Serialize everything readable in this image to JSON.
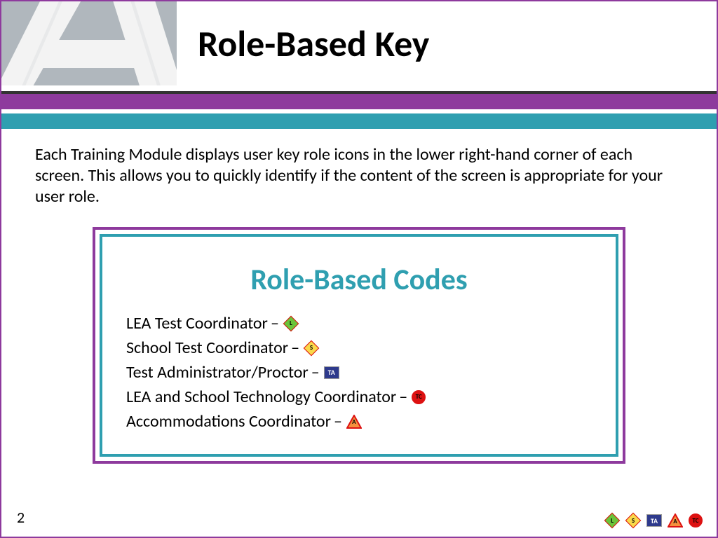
{
  "title": "Role-Based Key",
  "intro": "Each Training Module displays user key role icons in the lower right-hand corner of each screen. This allows you to quickly identify if the content of the screen is appropriate for your user role.",
  "codes_heading": "Role-Based Codes",
  "roles": [
    {
      "label": "LEA Test Coordinator",
      "badge": "L"
    },
    {
      "label": "School Test Coordinator",
      "badge": "S"
    },
    {
      "label": "Test Administrator/Proctor",
      "badge": "TA"
    },
    {
      "label": "LEA and School Technology Coordinator",
      "badge": "TC"
    },
    {
      "label": "Accommodations Coordinator",
      "badge": "A"
    }
  ],
  "badges": {
    "L": "L",
    "S": "S",
    "TA": "TA",
    "TC": "TC",
    "A": "A"
  },
  "separator": "–",
  "page_number": "2"
}
